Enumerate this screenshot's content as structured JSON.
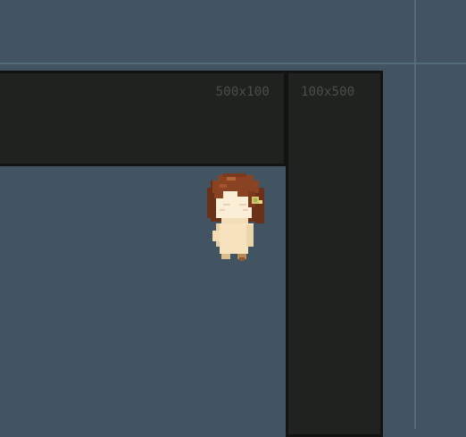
{
  "scene": {
    "background_color": "#425461",
    "guide_color": "#5b7482"
  },
  "blocks": {
    "horizontal": {
      "label": "500x100",
      "color": "#202220"
    },
    "vertical": {
      "label": "100x500",
      "color": "#202220"
    }
  },
  "player": {
    "sprite": "chibi-girl-character",
    "hair_color": "#7a3a1e",
    "body_color": "#f6e2bd"
  }
}
